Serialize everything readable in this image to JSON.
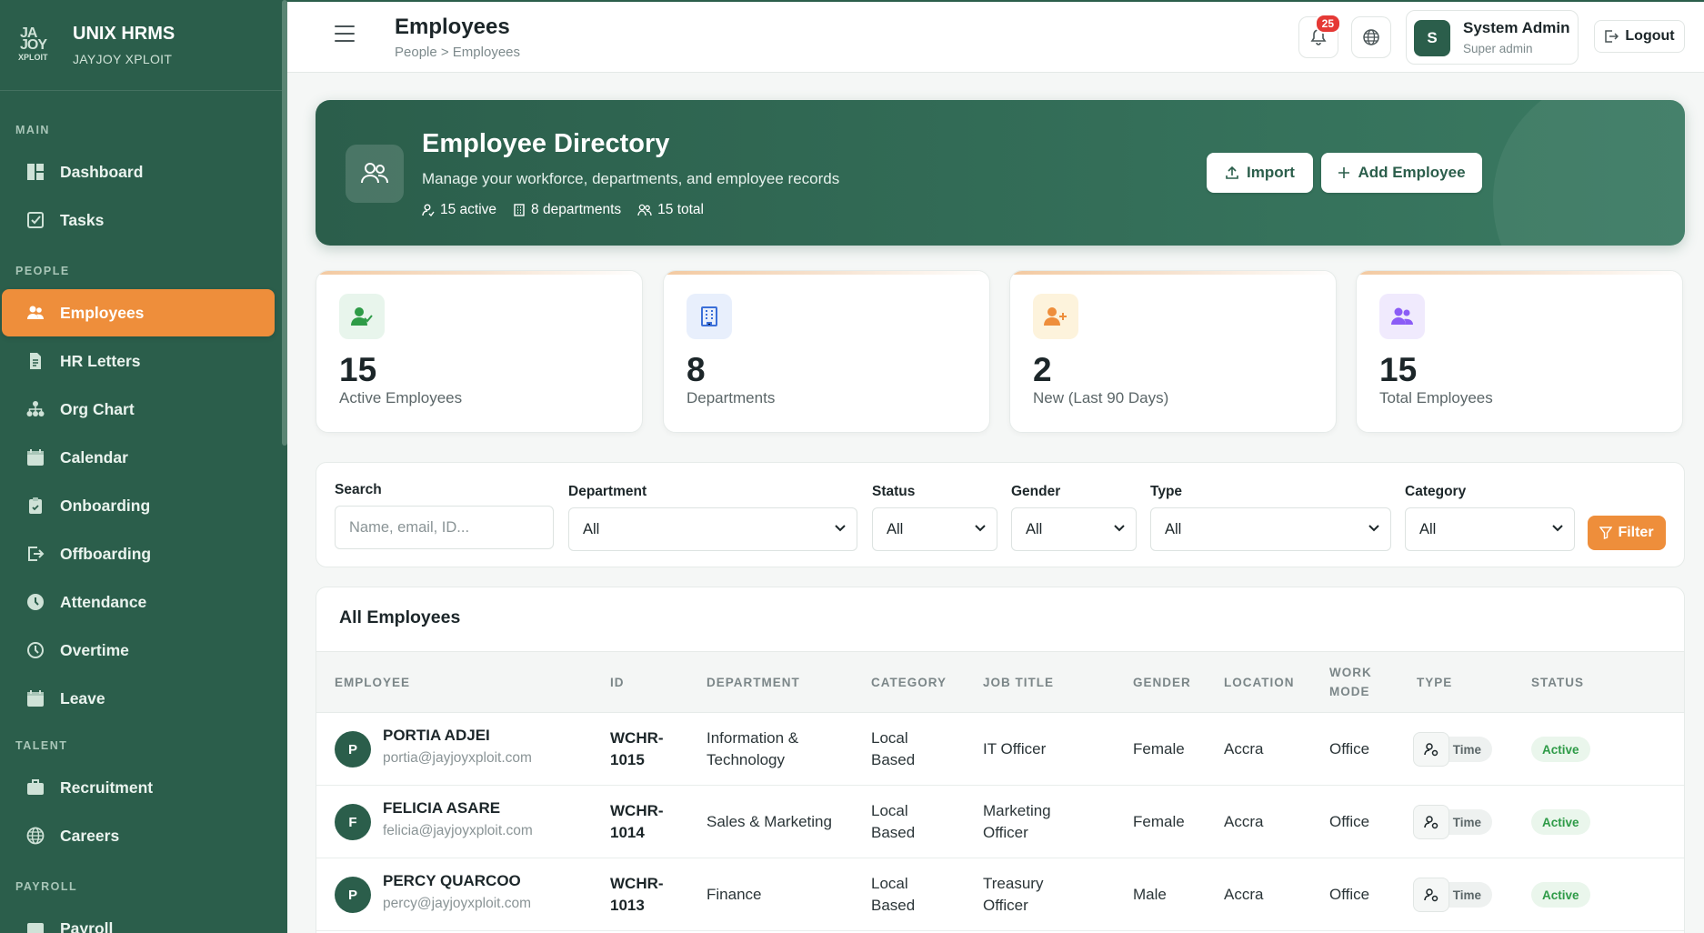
{
  "brand": {
    "logo_text_1": "JA",
    "logo_text_2": "JOY",
    "logo_text_3": "XPLOIT",
    "title": "UNIX HRMS",
    "subtitle": "JAYJOY XPLOIT"
  },
  "sidebar": {
    "sections": [
      "MAIN",
      "PEOPLE",
      "TALENT",
      "PAYROLL"
    ],
    "items": [
      {
        "label": "Dashboard",
        "icon": "dashboard-icon"
      },
      {
        "label": "Tasks",
        "icon": "checkbox-icon"
      },
      {
        "label": "Employees",
        "icon": "users-icon",
        "active": true
      },
      {
        "label": "HR Letters",
        "icon": "document-icon"
      },
      {
        "label": "Org Chart",
        "icon": "org-chart-icon"
      },
      {
        "label": "Calendar",
        "icon": "calendar-icon"
      },
      {
        "label": "Onboarding",
        "icon": "clipboard-icon"
      },
      {
        "label": "Offboarding",
        "icon": "exit-icon"
      },
      {
        "label": "Attendance",
        "icon": "clock-icon"
      },
      {
        "label": "Overtime",
        "icon": "clock-outline-icon"
      },
      {
        "label": "Leave",
        "icon": "calendar-icon"
      },
      {
        "label": "Recruitment",
        "icon": "briefcase-icon"
      },
      {
        "label": "Careers",
        "icon": "globe-icon"
      },
      {
        "label": "Payroll",
        "icon": "wallet-icon"
      }
    ]
  },
  "header": {
    "title": "Employees",
    "breadcrumb": "People > Employees",
    "notifications": "25",
    "user_initial": "S",
    "user_name": "System Admin",
    "user_role": "Super admin",
    "logout_label": "Logout"
  },
  "hero": {
    "title": "Employee Directory",
    "subtitle": "Manage your workforce, departments, and employee records",
    "stat_active": "15 active",
    "stat_departments": "8 departments",
    "stat_total": "15 total",
    "import_label": "Import",
    "add_label": "Add Employee"
  },
  "stats": [
    {
      "value": "15",
      "label": "Active Employees",
      "color": "#2e9b47",
      "bg": "#e8f5ec"
    },
    {
      "value": "8",
      "label": "Departments",
      "color": "#3b6fd8",
      "bg": "#e8effc"
    },
    {
      "value": "2",
      "label": "New (Last 90 Days)",
      "color": "#ee8e3b",
      "bg": "#fdf3dc"
    },
    {
      "value": "15",
      "label": "Total Employees",
      "color": "#8b5cf6",
      "bg": "#f0eafd"
    }
  ],
  "filters": {
    "search_label": "Search",
    "search_placeholder": "Name, email, ID...",
    "department_label": "Department",
    "department_value": "All",
    "status_label": "Status",
    "status_value": "All",
    "gender_label": "Gender",
    "gender_value": "All",
    "type_label": "Type",
    "type_value": "All",
    "category_label": "Category",
    "category_value": "All",
    "filter_button": "Filter"
  },
  "table": {
    "title": "All Employees",
    "headers": [
      "EMPLOYEE",
      "ID",
      "DEPARTMENT",
      "CATEGORY",
      "JOB TITLE",
      "GENDER",
      "LOCATION",
      "WORK MODE",
      "TYPE",
      "STATUS"
    ],
    "rows": [
      {
        "initial": "P",
        "name": "PORTIA ADJEI",
        "email": "portia@jayjoyxploit.com",
        "id_1": "WCHR-",
        "id_2": "1015",
        "dept_1": "Information &",
        "dept_2": "Technology",
        "cat_1": "Local",
        "cat_2": "Based",
        "job_1": "IT Officer",
        "job_2": "",
        "gender": "Female",
        "location": "Accra",
        "mode": "Office",
        "type": "Full Time",
        "status": "Active"
      },
      {
        "initial": "F",
        "name": "FELICIA ASARE",
        "email": "felicia@jayjoyxploit.com",
        "id_1": "WCHR-",
        "id_2": "1014",
        "dept_1": "Sales & Marketing",
        "dept_2": "",
        "cat_1": "Local",
        "cat_2": "Based",
        "job_1": "Marketing",
        "job_2": "Officer",
        "gender": "Female",
        "location": "Accra",
        "mode": "Office",
        "type": "Full Time",
        "status": "Active"
      },
      {
        "initial": "P",
        "name": "PERCY QUARCOO",
        "email": "percy@jayjoyxploit.com",
        "id_1": "WCHR-",
        "id_2": "1013",
        "dept_1": "Finance",
        "dept_2": "",
        "cat_1": "Local",
        "cat_2": "Based",
        "job_1": "Treasury",
        "job_2": "Officer",
        "gender": "Male",
        "location": "Accra",
        "mode": "Office",
        "type": "Full Time",
        "status": "Active"
      }
    ]
  }
}
